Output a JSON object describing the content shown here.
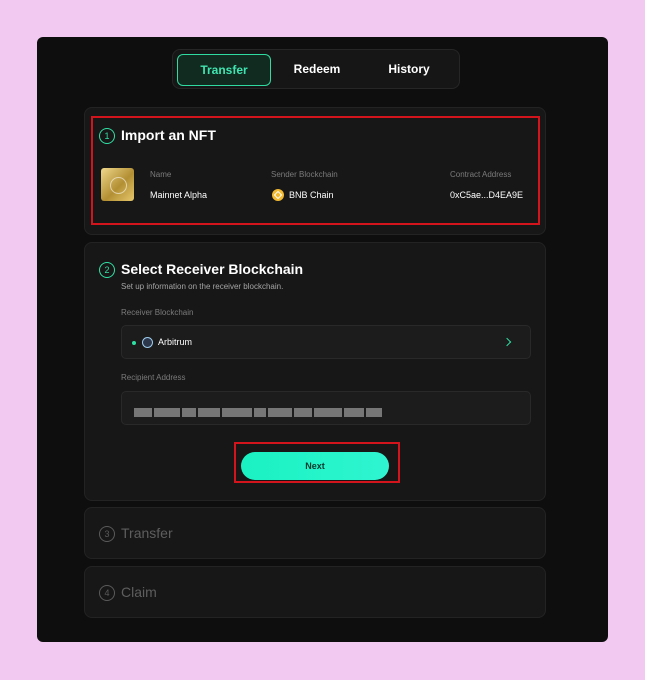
{
  "tabs": [
    {
      "label": "Transfer",
      "active": true
    },
    {
      "label": "Redeem",
      "active": false
    },
    {
      "label": "History",
      "active": false
    }
  ],
  "step1": {
    "number": "1",
    "title": "Import an NFT",
    "name_label": "Name",
    "name_value": "Mainnet Alpha",
    "chain_label": "Sender Blockchain",
    "chain_value": "BNB Chain",
    "contract_label": "Contract Address",
    "contract_value": "0xC5ae...D4EA9E"
  },
  "step2": {
    "number": "2",
    "title": "Select Receiver Blockchain",
    "subtitle": "Set up information on the receiver blockchain.",
    "receiver_label": "Receiver Blockchain",
    "receiver_value": "Arbitrum",
    "recipient_label": "Recipient Address",
    "next_label": "Next"
  },
  "step3": {
    "number": "3",
    "title": "Transfer"
  },
  "step4": {
    "number": "4",
    "title": "Claim"
  },
  "colors": {
    "accent": "#2fe0a4",
    "highlight": "#d3141d",
    "background": "#f2c9f1",
    "panel": "#0e0e0e"
  }
}
